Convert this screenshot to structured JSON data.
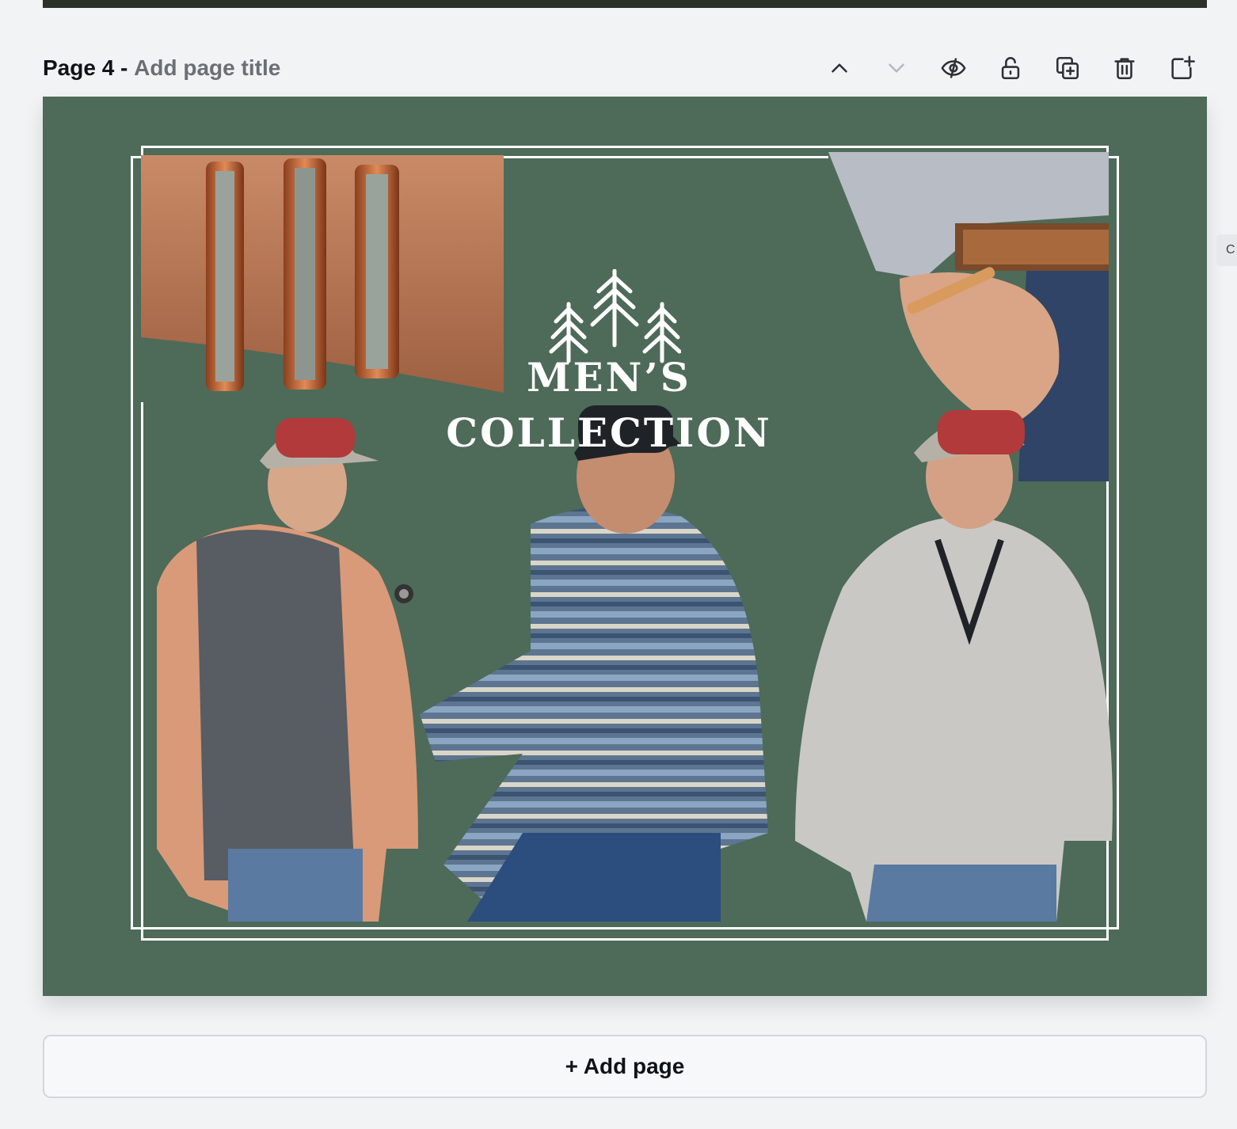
{
  "page": {
    "number_label": "Page 4 -",
    "title_placeholder": "Add page title"
  },
  "toolbar": {
    "icons": [
      "chevron-up-icon",
      "chevron-down-icon",
      "hide-eye-icon",
      "lock-icon",
      "duplicate-page-icon",
      "trash-icon",
      "add-page-icon"
    ]
  },
  "design": {
    "title": "MEN’S COLLECTION",
    "background_color": "#4e6a59",
    "frame_color": "#ffffff",
    "photos": [
      "bracelets-closeup-photo",
      "wrist-bracelet-belt-photo",
      "man-gray-hoodie-photo",
      "man-striped-pullover-photo",
      "man-knit-pullover-photo"
    ]
  },
  "side_tab": {
    "label": "C"
  },
  "footer": {
    "add_page_label": "+ Add page"
  }
}
